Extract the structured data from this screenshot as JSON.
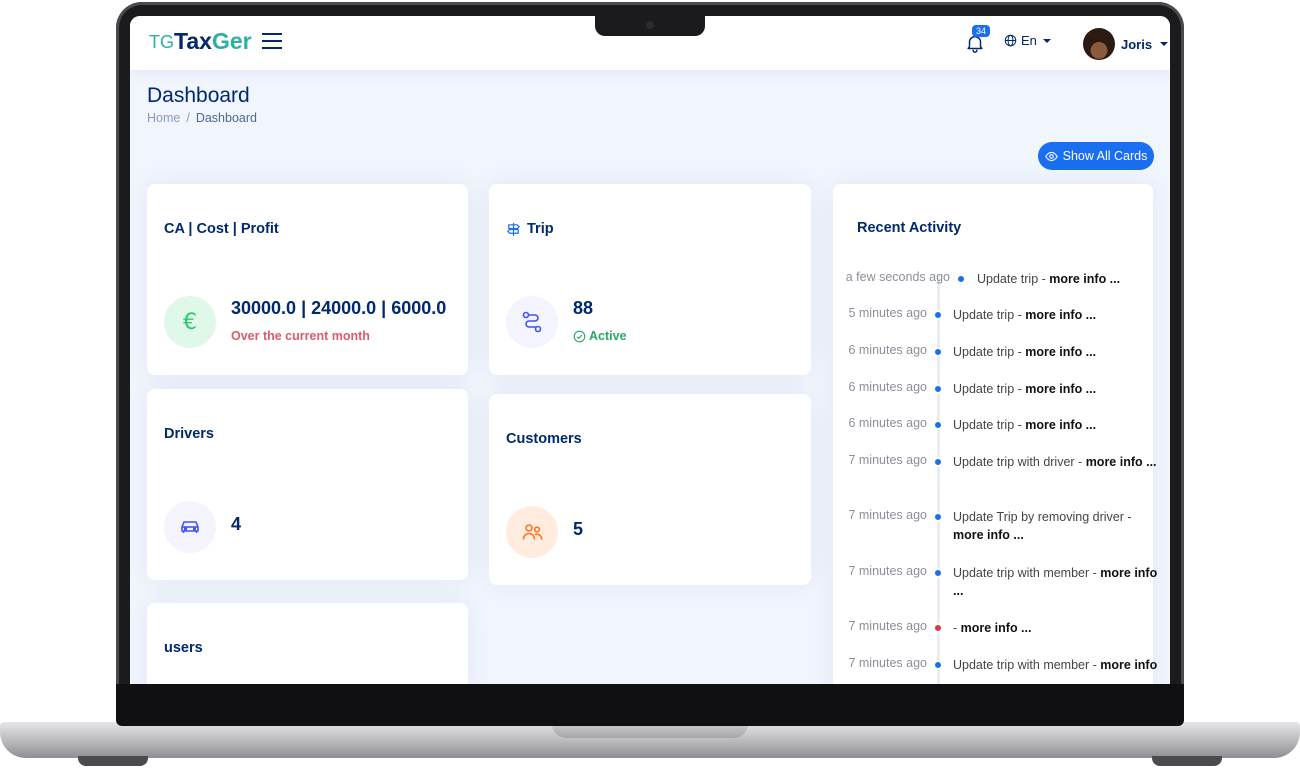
{
  "header": {
    "logo_mark": "TG",
    "logo_name_part1": "Tax",
    "logo_name_part2": "Ger",
    "notification_count": "34",
    "language": "En",
    "user_name": "Joris"
  },
  "page": {
    "title": "Dashboard",
    "breadcrumb": [
      "Home",
      "Dashboard"
    ],
    "show_all_cards_label": "Show All Cards"
  },
  "cards": {
    "ca": {
      "title": "CA | Cost | Profit",
      "value": "30000.0 | 24000.0 | 6000.0",
      "subtitle": "Over the current month",
      "icon": "euro-icon"
    },
    "trip": {
      "title": "Trip",
      "value": "88",
      "subtitle": "Active",
      "icon": "route-icon"
    },
    "drivers": {
      "title": "Drivers",
      "value": "4",
      "icon": "car-icon"
    },
    "customers": {
      "title": "Customers",
      "value": "5",
      "icon": "users-icon"
    },
    "users": {
      "title": "users"
    }
  },
  "activity": {
    "title": "Recent Activity",
    "items": [
      {
        "time": "a few seconds ago",
        "text": "Update trip - ",
        "link": "more info ...",
        "color": "blue"
      },
      {
        "time": "5 minutes ago",
        "text": "Update trip - ",
        "link": "more info ...",
        "color": "blue"
      },
      {
        "time": "6 minutes ago",
        "text": "Update trip - ",
        "link": "more info ...",
        "color": "blue"
      },
      {
        "time": "6 minutes ago",
        "text": "Update trip - ",
        "link": "more info ...",
        "color": "blue"
      },
      {
        "time": "6 minutes ago",
        "text": "Update trip - ",
        "link": "more info ...",
        "color": "blue"
      },
      {
        "time": "7 minutes ago",
        "text": "Update trip with driver - ",
        "link": "more info ...",
        "color": "blue"
      },
      {
        "time": "7 minutes ago",
        "text": "Update Trip by removing driver - ",
        "link": "more info ...",
        "color": "blue"
      },
      {
        "time": "7 minutes ago",
        "text": "Update trip with member - ",
        "link": "more info ...",
        "color": "blue"
      },
      {
        "time": "7 minutes ago",
        "text": " - ",
        "link": "more info ...",
        "color": "red"
      },
      {
        "time": "7 minutes ago",
        "text": "Update trip with member - ",
        "link": "more info",
        "color": "blue"
      }
    ]
  },
  "colors": {
    "primary": "#1a6ef0",
    "navy": "#012970",
    "teal": "#2ab0a5",
    "red": "#dc5b6b",
    "green": "#2fa66a",
    "danger_dot": "#dc3545"
  }
}
